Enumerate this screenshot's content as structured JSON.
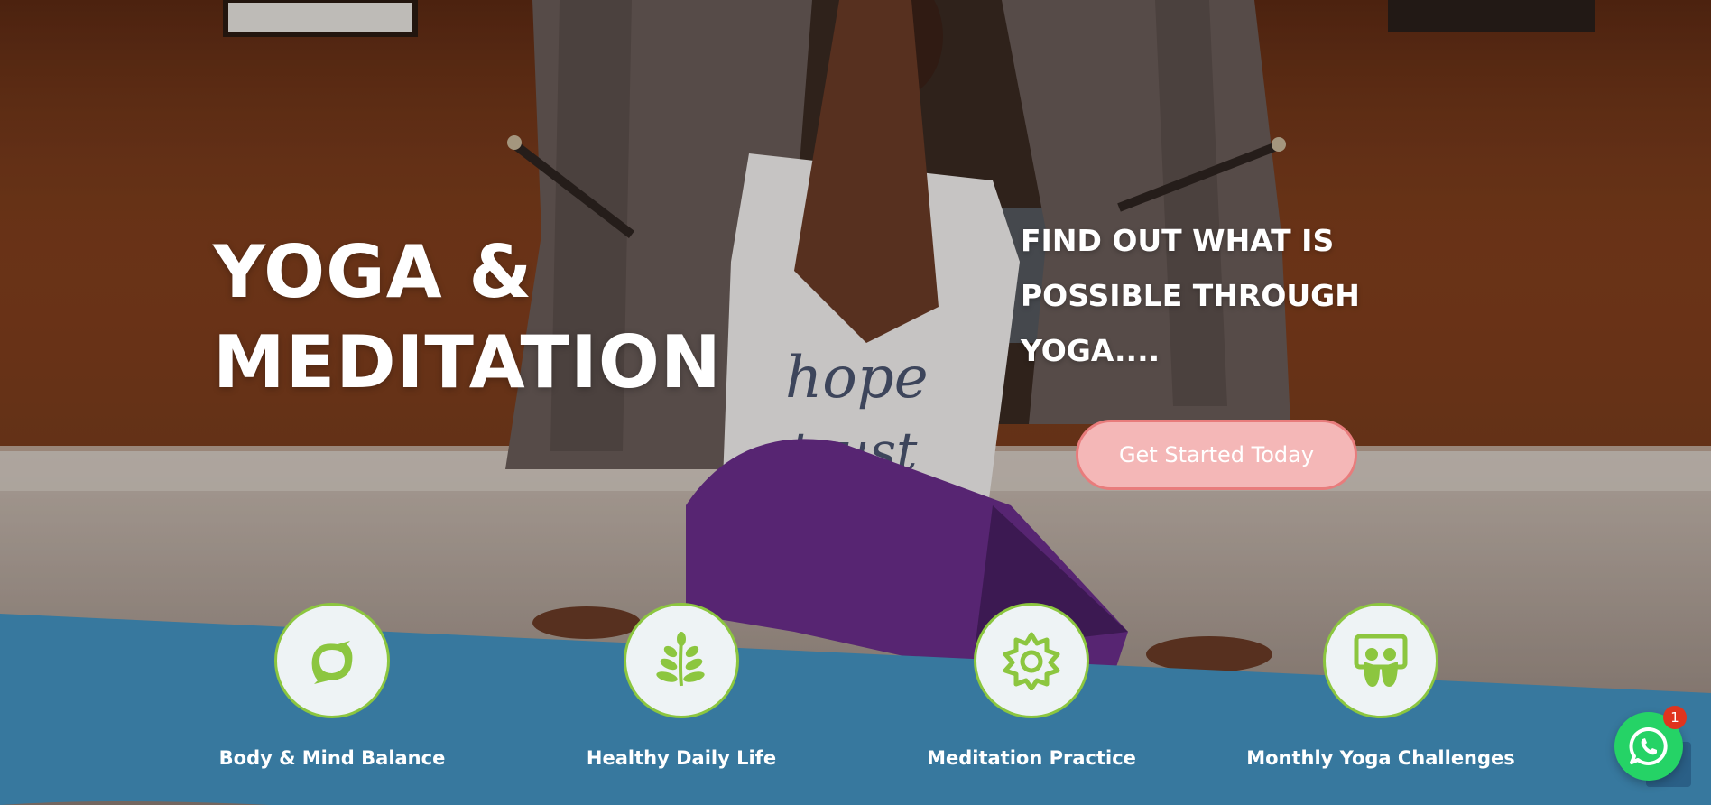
{
  "hero": {
    "title_line1": "YOGA &",
    "title_line2": "MEDITATION",
    "tagline_line1": "FIND OUT WHAT IS",
    "tagline_line2": "POSSIBLE THROUGH",
    "tagline_line3": "YOGA....",
    "cta_label": "Get Started Today"
  },
  "features": [
    {
      "label": "Body & Mind Balance",
      "icon": "swirl-icon"
    },
    {
      "label": "Healthy Daily Life",
      "icon": "sprout-icon"
    },
    {
      "label": "Meditation Practice",
      "icon": "gear-flower-icon"
    },
    {
      "label": "Monthly Yoga Challenges",
      "icon": "slideshare-icon"
    }
  ],
  "whatsapp": {
    "badge_count": "1",
    "icon": "whatsapp-icon"
  },
  "colors": {
    "band": "#37789e",
    "accent_green": "#8cc63f",
    "cta_bg": "#f4b7b7",
    "cta_border": "#e87c7c",
    "whatsapp": "#25d366"
  }
}
